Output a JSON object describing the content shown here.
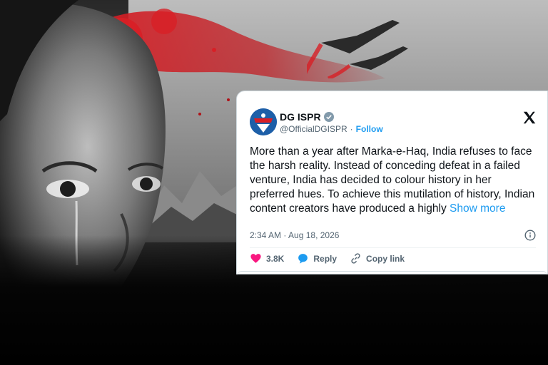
{
  "tweet": {
    "display_name": "DG ISPR",
    "handle": "@OfficialDGISPR",
    "separator": "·",
    "follow_label": "Follow",
    "body": "More than a year after Marka-e-Haq, India refuses to face the harsh reality. Instead of conceding defeat in a failed venture, India has decided to colour history in her preferred hues. To achieve this mutilation of history, Indian content creators have produced a highly",
    "show_more_label": "Show more",
    "timestamp": "2:34 AM · Aug 18, 2026",
    "likes": "3.8K",
    "reply_label": "Reply",
    "copy_link_label": "Copy link"
  },
  "colors": {
    "link_blue": "#1d9bf0",
    "like_pink": "#f91880",
    "splash_red": "#d81f26"
  },
  "icons": {
    "brand": "x-logo-icon",
    "verified": "verified-badge-icon",
    "like": "heart-icon",
    "reply": "reply-bubble-icon",
    "copy_link": "link-icon",
    "info": "info-icon"
  }
}
